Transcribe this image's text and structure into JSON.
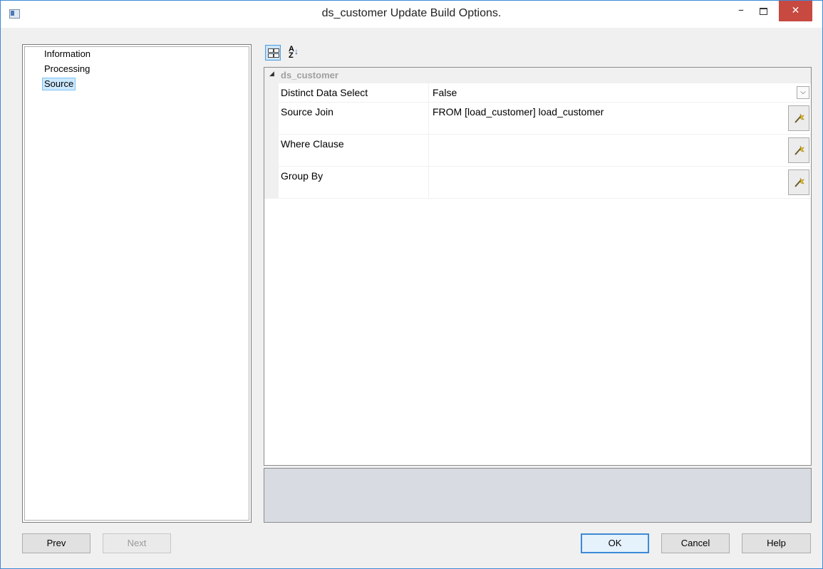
{
  "window": {
    "title": "ds_customer Update Build Options.",
    "minimize_glyph": "–",
    "close_glyph": "✕"
  },
  "tree": {
    "items": [
      {
        "label": "Information"
      },
      {
        "label": "Processing"
      },
      {
        "label": "Source",
        "selected": true
      }
    ]
  },
  "toolbar": {
    "categorized_icon": "categorized-view-icon",
    "alphabetical_icon": "sort-alphabetical-icon",
    "alpha_top": "A",
    "alpha_bottom": "Z",
    "alpha_arrow": "↓"
  },
  "grid": {
    "category": "ds_customer",
    "category_arrow": "◢",
    "properties": [
      {
        "name": "Distinct Data Select",
        "value": "False",
        "editor": "dropdown"
      },
      {
        "name": "Source Join",
        "value": "FROM [load_customer] load_customer",
        "editor": "button"
      },
      {
        "name": "Where Clause",
        "value": "",
        "editor": "button"
      },
      {
        "name": "Group By",
        "value": "",
        "editor": "button"
      }
    ],
    "dropdown_glyph": "⌵"
  },
  "buttons": {
    "prev": "Prev",
    "next": "Next",
    "ok": "OK",
    "cancel": "Cancel",
    "help": "Help"
  }
}
